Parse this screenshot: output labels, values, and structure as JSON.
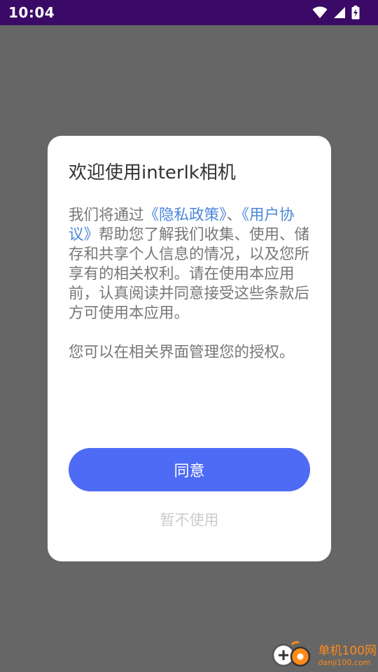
{
  "status_bar": {
    "time": "10:04"
  },
  "dialog": {
    "title": "欢迎使用interlk相机",
    "body": {
      "intro": "我们将通过",
      "privacy_link": "《隐私政策》",
      "separator": "、",
      "agreement_link": "《用户协议》",
      "rest": "帮助您了解我们收集、使用、储存和共享个人信息的情况，以及您所享有的相关权利。请在使用本应用前，认真阅读并同意接受这些条款后方可使用本应用。",
      "manage_note": "您可以在相关界面管理您的授权。"
    },
    "agree_label": "同意",
    "decline_label": "暂不使用"
  },
  "watermark": {
    "name": "单机100网",
    "url": "danji100.com"
  },
  "colors": {
    "status_bar_bg": "#3a0a66",
    "overlay_bg": "#666666",
    "accent": "#4d6bf4",
    "link": "#4a86d8",
    "watermark": "#ff8a1a"
  }
}
